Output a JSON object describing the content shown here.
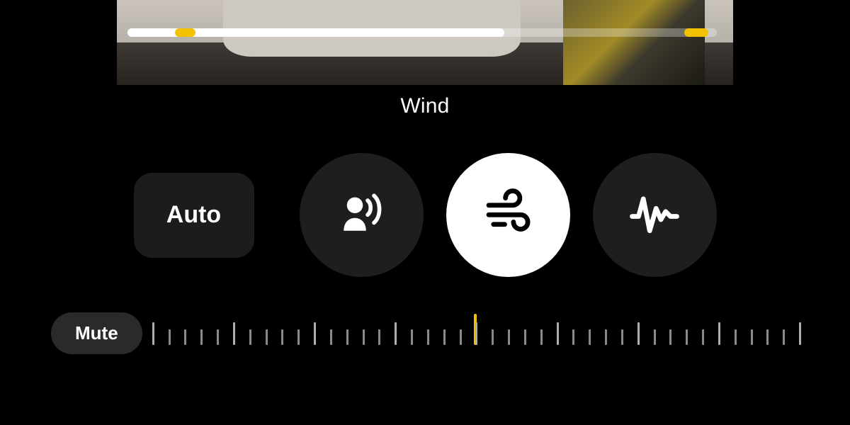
{
  "section_title": "Wind",
  "timeline": {
    "progress_pct": 64,
    "markers_pct": [
      8,
      94.5
    ]
  },
  "modes": {
    "auto_label": "Auto",
    "items": [
      {
        "id": "voice",
        "icon": "voice-isolation-icon",
        "selected": false
      },
      {
        "id": "wind",
        "icon": "wind-icon",
        "selected": true
      },
      {
        "id": "noise",
        "icon": "noise-icon",
        "selected": false
      }
    ]
  },
  "mute_label": "Mute",
  "slider": {
    "tick_count": 41,
    "major_every": 5,
    "pointer_position": 0.5
  },
  "colors": {
    "accent": "#f2c200",
    "card": "#1e1e1e",
    "selected_bg": "#ffffff"
  }
}
